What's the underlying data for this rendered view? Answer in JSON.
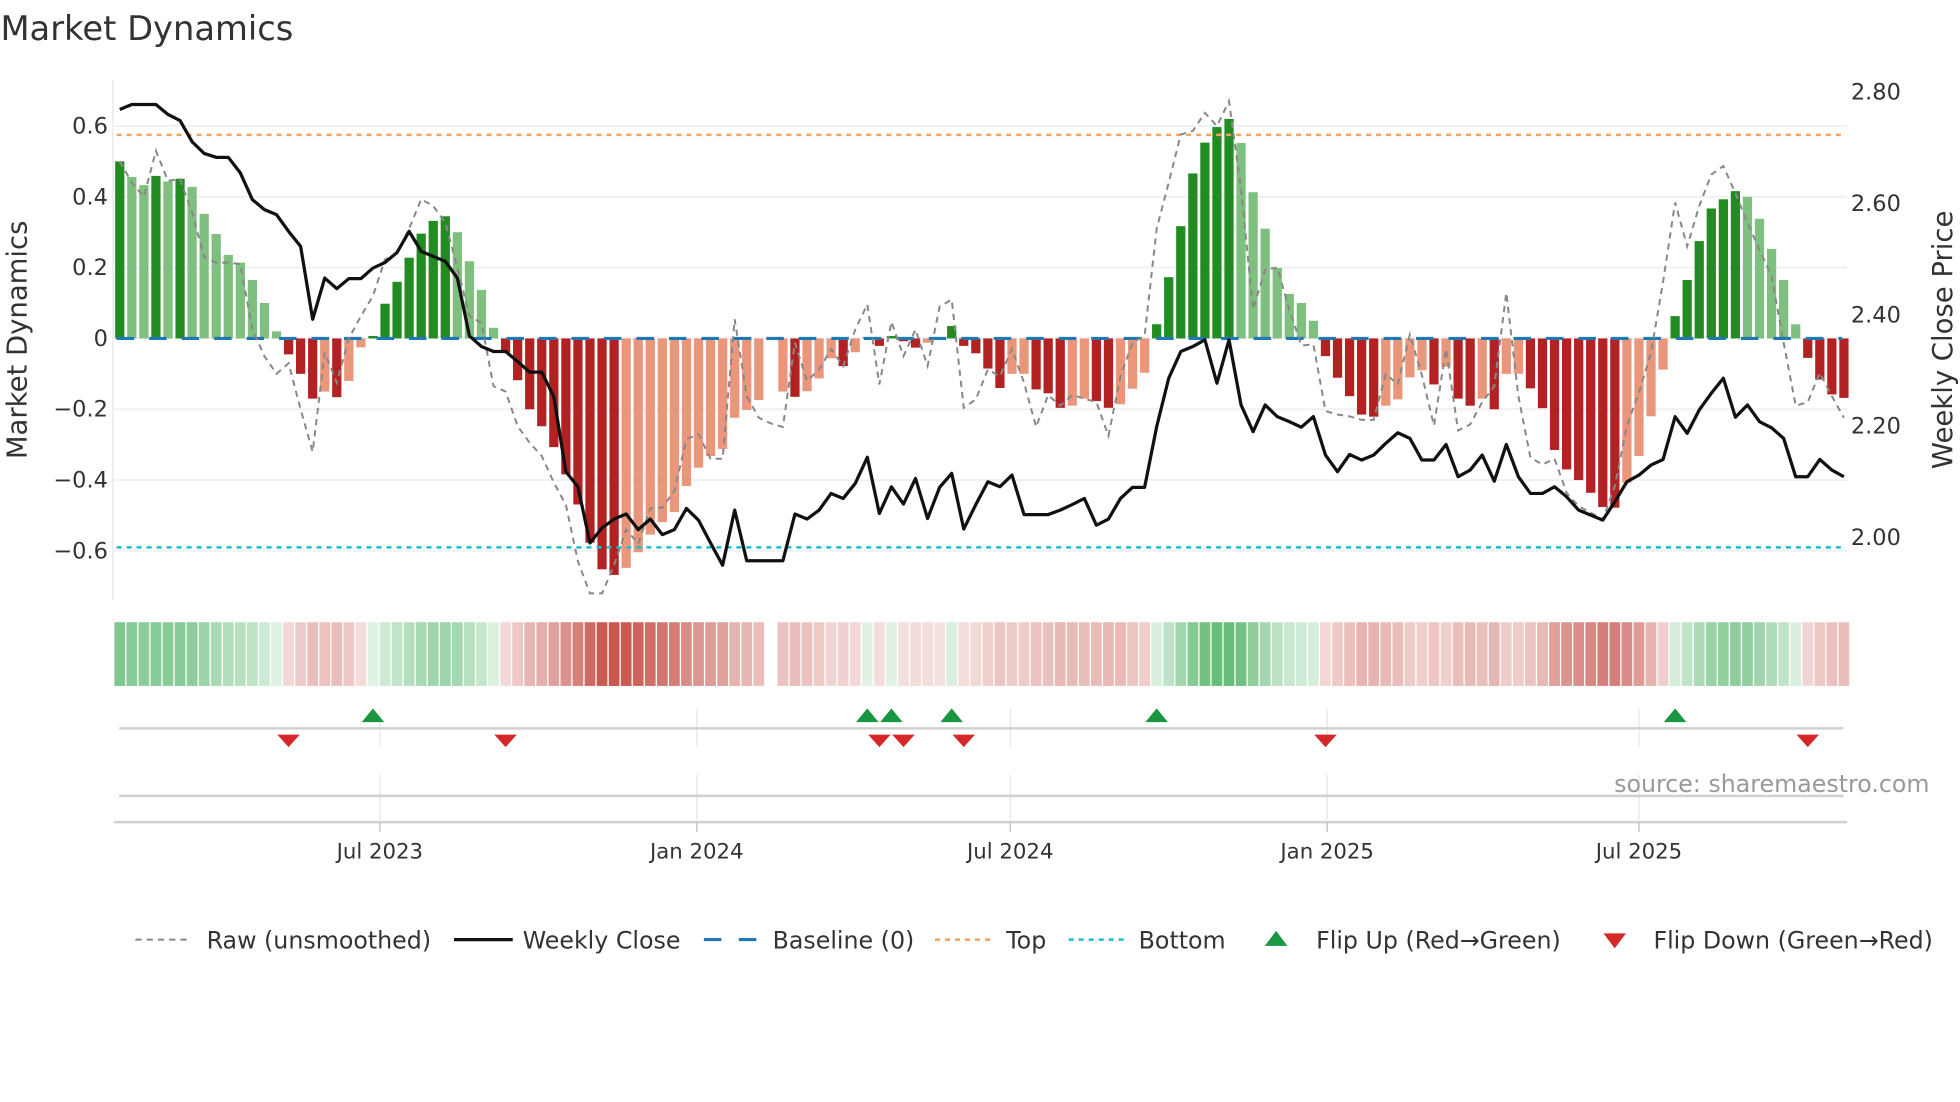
{
  "title": "Market Dynamics",
  "source": "source: sharemaestro.com",
  "colors": {
    "up_strong": "#228b22",
    "up_weak": "#7fbf7f",
    "down_strong": "#b22222",
    "down_weak": "#e9967a",
    "raw": "#888888",
    "close": "#111111",
    "baseline": "#1f77b4",
    "top": "#f4a460",
    "bottom": "#17becf",
    "flip_up": "#1a9641",
    "flip_down": "#d62728",
    "heat_green": "#5cb870",
    "heat_red": "#c8574f"
  },
  "chart_data": {
    "type": "bar",
    "title": "Market Dynamics",
    "ylabel": "Market Dynamics",
    "y2label": "Weekly Close Price",
    "start_date": "2023-01-31",
    "frequency": "weekly",
    "ylim": [
      -0.738,
      0.73
    ],
    "y2lim": [
      1.888,
      2.822
    ],
    "yticks": [
      {
        "v": 0.6,
        "label": "0.6"
      },
      {
        "v": 0.4,
        "label": "0.4"
      },
      {
        "v": 0.2,
        "label": "0.2"
      },
      {
        "v": 0,
        "label": "0"
      },
      {
        "v": -0.2,
        "label": "−0.2"
      },
      {
        "v": -0.4,
        "label": "−0.4"
      },
      {
        "v": -0.6,
        "label": "−0.6"
      }
    ],
    "y2ticks": [
      {
        "v": 2.8,
        "label": "2.80"
      },
      {
        "v": 2.6,
        "label": "2.60"
      },
      {
        "v": 2.4,
        "label": "2.40"
      },
      {
        "v": 2.2,
        "label": "2.20"
      },
      {
        "v": 2.0,
        "label": "2.00"
      }
    ],
    "xticks": [
      {
        "date": "2023-07-01",
        "label": "Jul 2023"
      },
      {
        "date": "2024-01-01",
        "label": "Jan 2024"
      },
      {
        "date": "2024-07-01",
        "label": "Jul 2024"
      },
      {
        "date": "2025-01-01",
        "label": "Jan 2025"
      },
      {
        "date": "2025-07-01",
        "label": "Jul 2025"
      }
    ],
    "top_level": 0.575,
    "bottom_level": -0.59,
    "baseline": 0,
    "dynamics": [
      0.5,
      0.456,
      0.433,
      0.459,
      0.443,
      0.451,
      0.428,
      0.352,
      0.295,
      0.236,
      0.214,
      0.165,
      0.1,
      0.02,
      -0.045,
      -0.1,
      -0.17,
      -0.15,
      -0.166,
      -0.12,
      -0.025,
      0.007,
      0.098,
      0.16,
      0.228,
      0.296,
      0.332,
      0.345,
      0.3,
      0.218,
      0.137,
      0.03,
      -0.04,
      -0.118,
      -0.2,
      -0.248,
      -0.307,
      -0.384,
      -0.469,
      -0.577,
      -0.652,
      -0.668,
      -0.648,
      -0.604,
      -0.554,
      -0.519,
      -0.49,
      -0.417,
      -0.365,
      -0.332,
      -0.312,
      -0.224,
      -0.202,
      -0.174,
      null,
      -0.15,
      -0.165,
      -0.149,
      -0.113,
      -0.056,
      -0.078,
      -0.039,
      0.003,
      -0.021,
      0.007,
      -0.008,
      -0.026,
      -0.012,
      -0.002,
      0.035,
      -0.021,
      -0.042,
      -0.085,
      -0.14,
      -0.1,
      -0.1,
      -0.144,
      -0.155,
      -0.196,
      -0.19,
      -0.17,
      -0.177,
      -0.196,
      -0.186,
      -0.142,
      -0.097,
      0.04,
      0.173,
      0.317,
      0.466,
      0.553,
      0.597,
      0.62,
      0.552,
      0.413,
      0.31,
      0.199,
      0.126,
      0.1,
      0.05,
      -0.05,
      -0.111,
      -0.163,
      -0.215,
      -0.221,
      -0.19,
      -0.172,
      -0.11,
      -0.09,
      -0.13,
      -0.08,
      -0.17,
      -0.19,
      -0.17,
      -0.2,
      -0.1,
      -0.1,
      -0.141,
      -0.197,
      -0.315,
      -0.37,
      -0.4,
      -0.436,
      -0.476,
      -0.478,
      -0.408,
      -0.332,
      -0.22,
      -0.088,
      0.063,
      0.165,
      0.275,
      0.367,
      0.393,
      0.416,
      0.4,
      0.338,
      0.253,
      0.165,
      0.04,
      -0.055,
      -0.116,
      -0.158,
      -0.168
    ],
    "raw": [
      0.5,
      0.44,
      0.4,
      0.53,
      0.445,
      0.45,
      0.355,
      0.23,
      0.214,
      0.214,
      0.21,
      0.025,
      -0.05,
      -0.1,
      -0.07,
      -0.2,
      -0.32,
      -0.04,
      -0.125,
      0,
      0.063,
      0.12,
      0.223,
      0.24,
      0.31,
      0.393,
      0.374,
      0.327,
      0.2,
      0.063,
      0.044,
      -0.135,
      -0.15,
      -0.248,
      -0.295,
      -0.332,
      -0.407,
      -0.47,
      -0.63,
      -0.72,
      -0.72,
      -0.64,
      -0.54,
      -0.58,
      -0.48,
      -0.478,
      -0.43,
      -0.285,
      -0.27,
      -0.34,
      -0.34,
      0.054,
      -0.163,
      -0.224,
      -0.24,
      -0.25,
      -0.012,
      -0.12,
      -0.088,
      -0.03,
      -0.078,
      0.025,
      0.096,
      -0.13,
      0.047,
      -0.05,
      0.025,
      -0.078,
      0.09,
      0.11,
      -0.196,
      -0.172,
      -0.088,
      -0.107,
      -0.03,
      -0.125,
      -0.25,
      -0.16,
      -0.19,
      -0.16,
      -0.17,
      -0.18,
      -0.275,
      -0.107,
      -0.012,
      0.007,
      0.31,
      0.44,
      0.576,
      0.586,
      0.637,
      0.6,
      0.67,
      0.42,
      0.082,
      0.195,
      0.2,
      0.082,
      -0.02,
      -0.017,
      -0.205,
      -0.215,
      -0.22,
      -0.23,
      -0.23,
      -0.1,
      -0.13,
      0.011,
      -0.104,
      -0.246,
      -0.03,
      -0.26,
      -0.243,
      -0.18,
      -0.135,
      0.129,
      -0.163,
      -0.337,
      -0.356,
      -0.34,
      -0.436,
      -0.474,
      -0.492,
      -0.511,
      -0.417,
      -0.246,
      -0.153,
      -0.04,
      0.16,
      0.384,
      0.26,
      0.374,
      0.463,
      0.487,
      0.41,
      0.327,
      0.25,
      0.176,
      -0.012,
      -0.19,
      -0.18,
      -0.097,
      -0.163,
      -0.224
    ],
    "close": [
      2.769,
      2.778,
      2.778,
      2.778,
      2.76,
      2.749,
      2.711,
      2.69,
      2.683,
      2.683,
      2.655,
      2.607,
      2.589,
      2.58,
      2.55,
      2.523,
      2.392,
      2.466,
      2.447,
      2.465,
      2.465,
      2.484,
      2.494,
      2.512,
      2.55,
      2.514,
      2.505,
      2.496,
      2.466,
      2.362,
      2.343,
      2.334,
      2.334,
      2.316,
      2.297,
      2.297,
      2.253,
      2.118,
      2.091,
      1.99,
      2.017,
      2.033,
      2.042,
      2.014,
      2.033,
      2.005,
      2.014,
      2.052,
      2.031,
      1.99,
      1.95,
      2.049,
      1.958,
      1.958,
      1.958,
      1.958,
      2.042,
      2.033,
      2.049,
      2.079,
      2.07,
      2.097,
      2.144,
      2.043,
      2.091,
      2.06,
      2.106,
      2.034,
      2.09,
      2.115,
      2.015,
      2.059,
      2.1,
      2.091,
      2.112,
      2.041,
      2.041,
      2.041,
      2.049,
      2.059,
      2.07,
      2.022,
      2.033,
      2.07,
      2.09,
      2.09,
      2.199,
      2.286,
      2.334,
      2.343,
      2.355,
      2.277,
      2.355,
      2.238,
      2.19,
      2.238,
      2.217,
      2.208,
      2.198,
      2.217,
      2.148,
      2.118,
      2.149,
      2.139,
      2.148,
      2.169,
      2.188,
      2.178,
      2.139,
      2.139,
      2.167,
      2.109,
      2.121,
      2.148,
      2.101,
      2.167,
      2.109,
      2.079,
      2.079,
      2.091,
      2.073,
      2.049,
      2.04,
      2.031,
      2.064,
      2.1,
      2.112,
      2.13,
      2.14,
      2.217,
      2.187,
      2.229,
      2.259,
      2.286,
      2.216,
      2.238,
      2.208,
      2.197,
      2.178,
      2.109,
      2.109,
      2.14,
      2.121,
      2.109
    ],
    "flip_up_weeks": [
      21,
      62,
      64,
      69,
      86,
      129
    ],
    "flip_down_weeks": [
      14,
      32,
      63,
      65,
      70,
      100,
      140
    ],
    "legend_position": "bottom",
    "legend": {
      "raw": "Raw (unsmoothed)",
      "close": "Weekly Close",
      "baseline": "Baseline (0)",
      "top": "Top",
      "bottom": "Bottom",
      "flip_up": "Flip Up (Red→Green)",
      "flip_down": "Flip Down (Green→Red)"
    }
  }
}
